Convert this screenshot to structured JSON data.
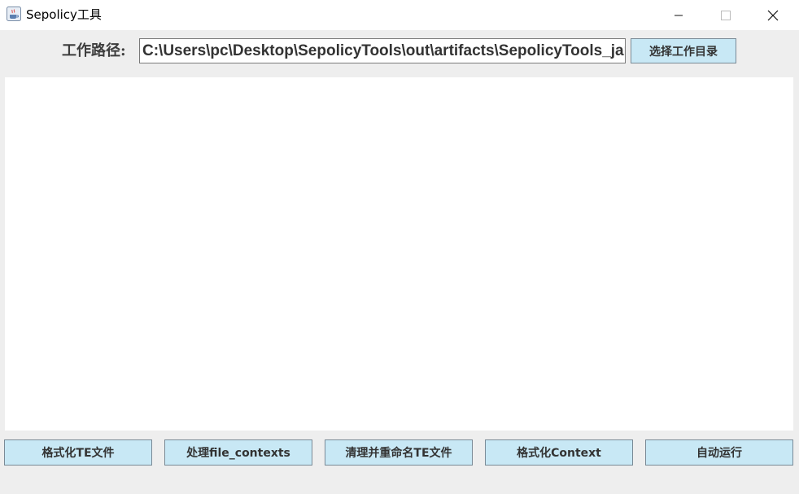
{
  "window": {
    "title": "Sepolicy工具",
    "app_icon": "java-coffee-cup-icon",
    "controls": [
      "minimize-icon",
      "maximize-icon",
      "close-icon"
    ]
  },
  "path": {
    "label": "工作路径:",
    "value": "C:\\Users\\pc\\Desktop\\SepolicyTools\\out\\artifacts\\SepolicyTools_jar",
    "choose_button": "选择工作目录"
  },
  "output": {
    "text": ""
  },
  "actions": [
    {
      "label": "格式化TE文件"
    },
    {
      "label": "处理file_contexts"
    },
    {
      "label": "清理并重命名TE文件"
    },
    {
      "label": "格式化Context"
    },
    {
      "label": "自动运行"
    }
  ],
  "colors": {
    "button_bg": "#c8e8f5",
    "window_bg": "#eeeeee",
    "titlebar_bg": "#ffffff"
  }
}
